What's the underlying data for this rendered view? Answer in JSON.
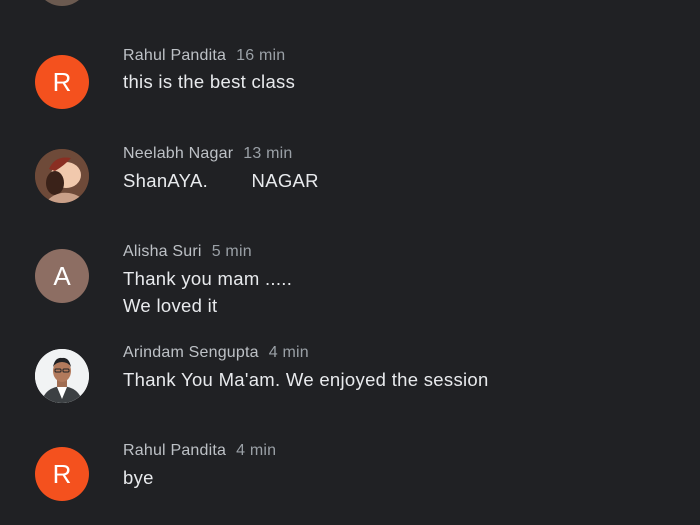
{
  "messages": [
    {
      "author": "Rahul Pandita",
      "time": "16 min",
      "avatar_letter": "R",
      "avatar_color": "#f4511e",
      "lines": [
        "this is the best class"
      ]
    },
    {
      "author": "Neelabh Nagar",
      "time": "13 min",
      "avatar_letter": "",
      "avatar_type": "photo",
      "lines": [
        "ShanAYA.        NAGAR"
      ]
    },
    {
      "author": "Alisha Suri",
      "time": "5 min",
      "avatar_letter": "A",
      "avatar_color": "#8d6e63",
      "lines": [
        "Thank you mam .....",
        "We loved it"
      ]
    },
    {
      "author": "Arindam Sengupta",
      "time": "4 min",
      "avatar_letter": "",
      "avatar_type": "photo",
      "lines": [
        "Thank You Ma'am. We enjoyed the session"
      ]
    },
    {
      "author": "Rahul Pandita",
      "time": "4 min",
      "avatar_letter": "R",
      "avatar_color": "#f4511e",
      "lines": [
        "bye"
      ]
    }
  ]
}
